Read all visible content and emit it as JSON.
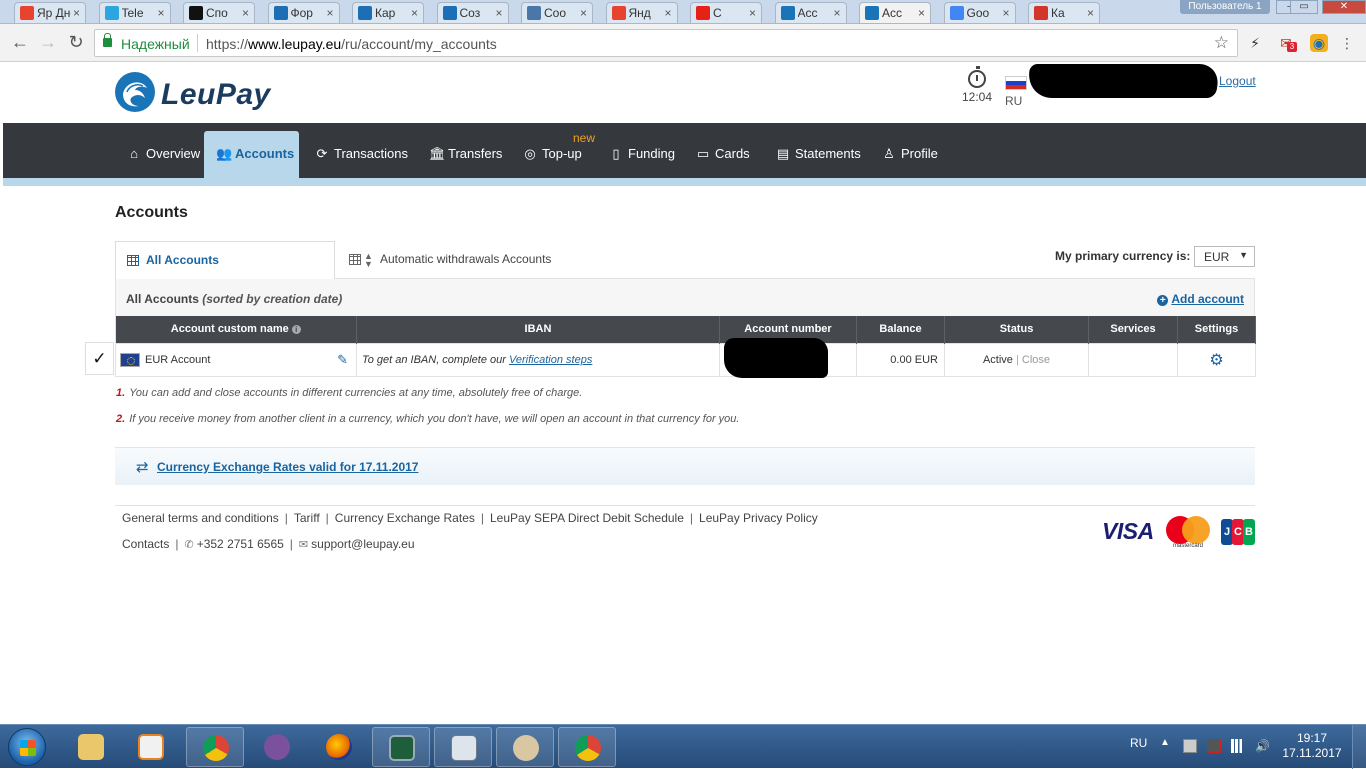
{
  "browser": {
    "tabs": [
      {
        "title": "Дне",
        "icon": "yandex-ya-icon",
        "color": "#e8432f",
        "prefix": "Яр"
      },
      {
        "title": "Tele",
        "icon": "telegram-icon",
        "color": "#2ca5e0"
      },
      {
        "title": "Спо",
        "icon": "t-icon",
        "color": "#111111"
      },
      {
        "title": "Фор",
        "icon": "kf-icon",
        "color": "#1c6fb5"
      },
      {
        "title": "Кар",
        "icon": "kf-icon",
        "color": "#1c6fb5"
      },
      {
        "title": "Соз",
        "icon": "kf-icon",
        "color": "#1c6fb5"
      },
      {
        "title": "Соо",
        "icon": "vk-icon",
        "color": "#4a76a8"
      },
      {
        "title": "Янд",
        "icon": "yandex-icon",
        "color": "#e8432f"
      },
      {
        "title": "С",
        "icon": "youtube-icon",
        "color": "#e62117"
      },
      {
        "title": "Acc",
        "icon": "leupay-icon",
        "color": "#1a75b8"
      },
      {
        "title": "Acc",
        "icon": "leupay-icon",
        "color": "#1a75b8",
        "active": true
      },
      {
        "title": "Goo",
        "icon": "google-icon",
        "color": "#4285f4"
      },
      {
        "title": "Ка",
        "icon": "star-red-icon",
        "color": "#d4352b"
      }
    ],
    "profile": "Пользователь 1",
    "secure_label": "Надежный",
    "url_scheme": "https://",
    "url_host": "www.leupay.eu",
    "url_path": "/ru/account/my_accounts",
    "ext_badge": "3"
  },
  "header": {
    "logo_text": "LeuPay",
    "timer": "12:04",
    "lang": "RU",
    "logout": "Logout"
  },
  "nav": {
    "items": [
      {
        "label": "Overview",
        "icon": "home-icon"
      },
      {
        "label": "Accounts",
        "icon": "users-icon",
        "active": true
      },
      {
        "label": "Transactions",
        "icon": "refresh-icon"
      },
      {
        "label": "Transfers",
        "icon": "bank-icon"
      },
      {
        "label": "Top-up",
        "icon": "coins-icon"
      },
      {
        "label": "Funding",
        "icon": "document-icon"
      },
      {
        "label": "Cards",
        "icon": "cards-icon"
      },
      {
        "label": "Statements",
        "icon": "statement-icon"
      },
      {
        "label": "Profile",
        "icon": "profile-icon"
      }
    ],
    "new_badge": "new"
  },
  "main": {
    "title": "Accounts",
    "tabs": {
      "all": "All Accounts",
      "auto": "Automatic withdrawals Accounts"
    },
    "currency_label": "My primary currency is:",
    "currency_value": "EUR",
    "panel_title": "All Accounts",
    "panel_subtitle": "(sorted by creation date)",
    "add_account": "Add account",
    "table": {
      "headers": [
        "Account custom name",
        "IBAN",
        "Account number",
        "Balance",
        "Status",
        "Services",
        "Settings"
      ],
      "rows": [
        {
          "name": "EUR Account",
          "iban_note": "To get an IBAN, complete our",
          "iban_link": "Verification steps",
          "balance": "0.00 EUR",
          "status": "Active",
          "status_sep": "|",
          "status_action": "Close"
        }
      ]
    },
    "check_mark": "✓",
    "notes": [
      {
        "num": "1.",
        "text": "You can add and close accounts in different currencies at any time, absolutely free of charge."
      },
      {
        "num": "2.",
        "text": "If you receive money from another client in a currency, which you don't have, we will open an account in that currency for you."
      }
    ],
    "rates_link": "Currency Exchange Rates valid for 17.11.2017"
  },
  "footer": {
    "links": [
      "General terms and conditions",
      "Tariff",
      "Currency Exchange Rates",
      "LeuPay SEPA Direct Debit Schedule",
      "LeuPay Privacy Policy"
    ],
    "contacts": "Contacts",
    "phone": "+352 2751 6565",
    "email": "support@leupay.eu",
    "card_brands": {
      "visa": "VISA",
      "mastercard": "mastercard",
      "jcb": "JCB"
    }
  },
  "taskbar": {
    "apps": [
      "explorer",
      "media-player",
      "chrome",
      "viber",
      "firefox",
      "terminal",
      "calculator",
      "paint",
      "chrome"
    ],
    "tray_lang": "RU",
    "time": "19:17",
    "date": "17.11.2017"
  }
}
